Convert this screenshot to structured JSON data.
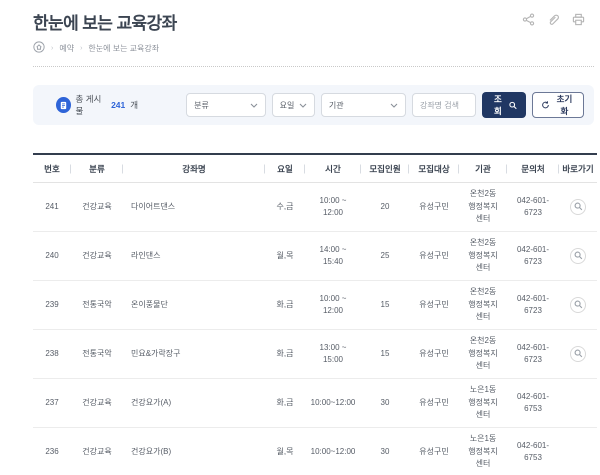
{
  "header": {
    "title": "한눈에 보는 교육강좌",
    "action_icons": [
      "share-icon",
      "attachment-icon",
      "print-icon"
    ]
  },
  "breadcrumb": {
    "home_icon": "home-icon",
    "items": [
      "예약",
      "한눈에 보는 교육강좌"
    ]
  },
  "filter": {
    "total_prefix": "총 게시물",
    "total_count": "241",
    "total_suffix": "개",
    "selects": [
      {
        "label": "분류"
      },
      {
        "label": "요일"
      },
      {
        "label": "기관"
      }
    ],
    "search_placeholder": "강좌명 검색",
    "search_button": "조회",
    "reset_button": "초기화"
  },
  "table": {
    "columns": [
      "번호",
      "분류",
      "강좌명",
      "요일",
      "시간",
      "모집인원",
      "모집대상",
      "기관",
      "문의처",
      "바로가기"
    ],
    "rows": [
      {
        "no": "241",
        "category": "건강교육",
        "name": "다이어트댄스",
        "day": "수,금",
        "time": "10:00 ~\n12:00",
        "capacity": "20",
        "target": "유성구민",
        "org": "온천2동\n행정복지\n센터",
        "phone": "042-601-\n6723",
        "has_link": true
      },
      {
        "no": "240",
        "category": "건강교육",
        "name": "라인댄스",
        "day": "월,목",
        "time": "14:00 ~\n15:40",
        "capacity": "25",
        "target": "유성구민",
        "org": "온천2동\n행정복지\n센터",
        "phone": "042-601-\n6723",
        "has_link": true
      },
      {
        "no": "239",
        "category": "전통국악",
        "name": "온이풍물단",
        "day": "화,금",
        "time": "10:00 ~\n12:00",
        "capacity": "15",
        "target": "유성구민",
        "org": "온천2동\n행정복지\n센터",
        "phone": "042-601-\n6723",
        "has_link": true
      },
      {
        "no": "238",
        "category": "전통국악",
        "name": "민요&가락장구",
        "day": "화,금",
        "time": "13:00 ~\n15:00",
        "capacity": "15",
        "target": "유성구민",
        "org": "온천2동\n행정복지\n센터",
        "phone": "042-601-\n6723",
        "has_link": true
      },
      {
        "no": "237",
        "category": "건강교육",
        "name": "건강요가(A)",
        "day": "화,금",
        "time": "10:00~12:00",
        "capacity": "30",
        "target": "유성구민",
        "org": "노은1동\n행정복지\n센터",
        "phone": "042-601-\n6753",
        "has_link": false
      },
      {
        "no": "236",
        "category": "건강교육",
        "name": "건강요가(B)",
        "day": "월,목",
        "time": "10:00~12:00",
        "capacity": "30",
        "target": "유성구민",
        "org": "노은1동\n행정복지\n센터",
        "phone": "042-601-\n6753",
        "has_link": false
      }
    ]
  },
  "colors": {
    "accent_blue": "#2e64d8",
    "button_navy": "#203763",
    "title_text": "#3c4552",
    "table_top_border": "#333d4e",
    "filter_bg": "#f3f6fb"
  }
}
